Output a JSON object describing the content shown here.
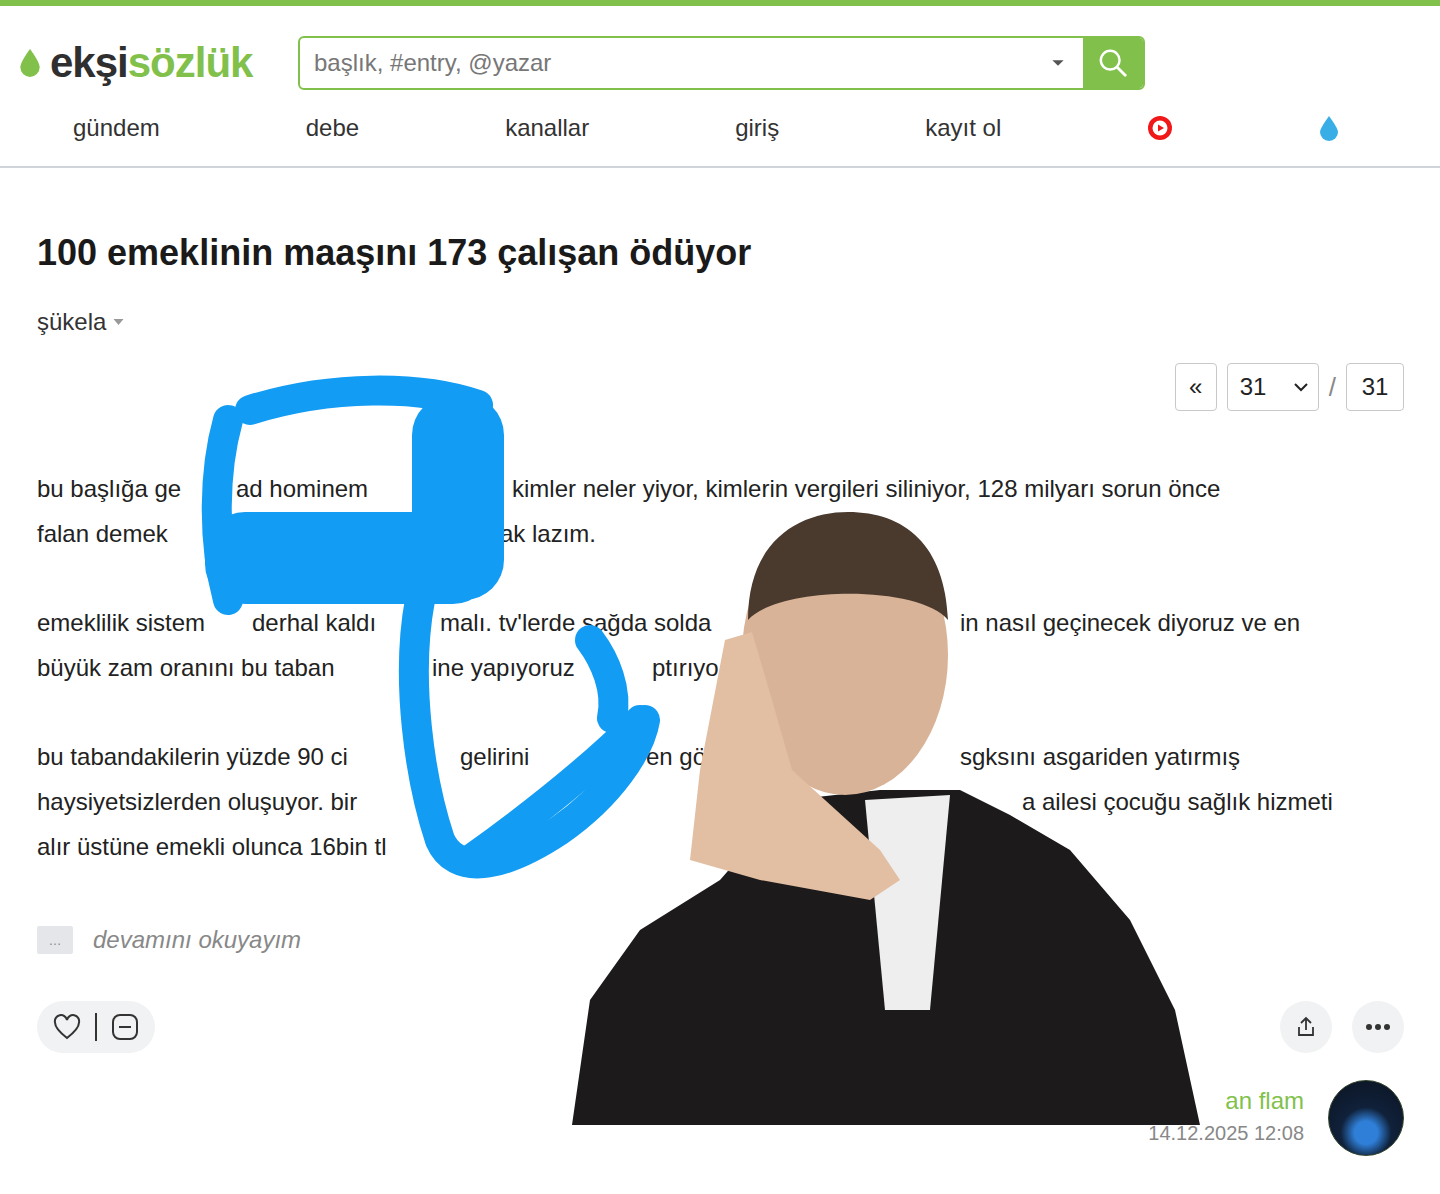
{
  "logo": {
    "first": "ekşi",
    "second": "sözlük"
  },
  "search": {
    "placeholder": "başlık, #entry, @yazar"
  },
  "nav": [
    {
      "label": "gündem"
    },
    {
      "label": "debe"
    },
    {
      "label": "kanallar"
    },
    {
      "label": "giriş"
    },
    {
      "label": "kayıt ol"
    }
  ],
  "topic": {
    "title": "100 emeklinin maaşını 173 çalışan ödüyor"
  },
  "sort": {
    "label": "şükela"
  },
  "pagination": {
    "prev": "«",
    "current": "31",
    "separator": "/",
    "total": "31"
  },
  "entry": {
    "paragraphs": [
      [
        [
          "bu başlığa ge",
          "ad hominem",
          "kimler neler yiyor, kimlerin vergileri siliniyor, 128 milyarı sorun önce"
        ],
        [
          "falan demek",
          "ak lazım."
        ]
      ],
      [
        [
          "emeklilik sistem",
          "derhal kaldı",
          "malı. tv'lerde sağda solda",
          "in nasıl geçinecek diyoruz ve en"
        ],
        [
          "büyük zam oranını bu taban",
          "ine yapıyoruz",
          "ptırıyo"
        ]
      ],
      [
        [
          "bu tabandakilerin yüzde 90 ci",
          "gelirini",
          "en gö",
          "sgksını asgariden yatırmış"
        ],
        [
          "haysiyetsizlerden oluşuyor. bir",
          "a ailesi çocuğu sağlık hizmeti"
        ],
        [
          "alır üstüne emekli olunca 16bin tl"
        ]
      ]
    ],
    "more_marker": "…",
    "more_label": "devamını okuyayım",
    "author": "an flam",
    "date": "14.12.2025 12:08"
  }
}
